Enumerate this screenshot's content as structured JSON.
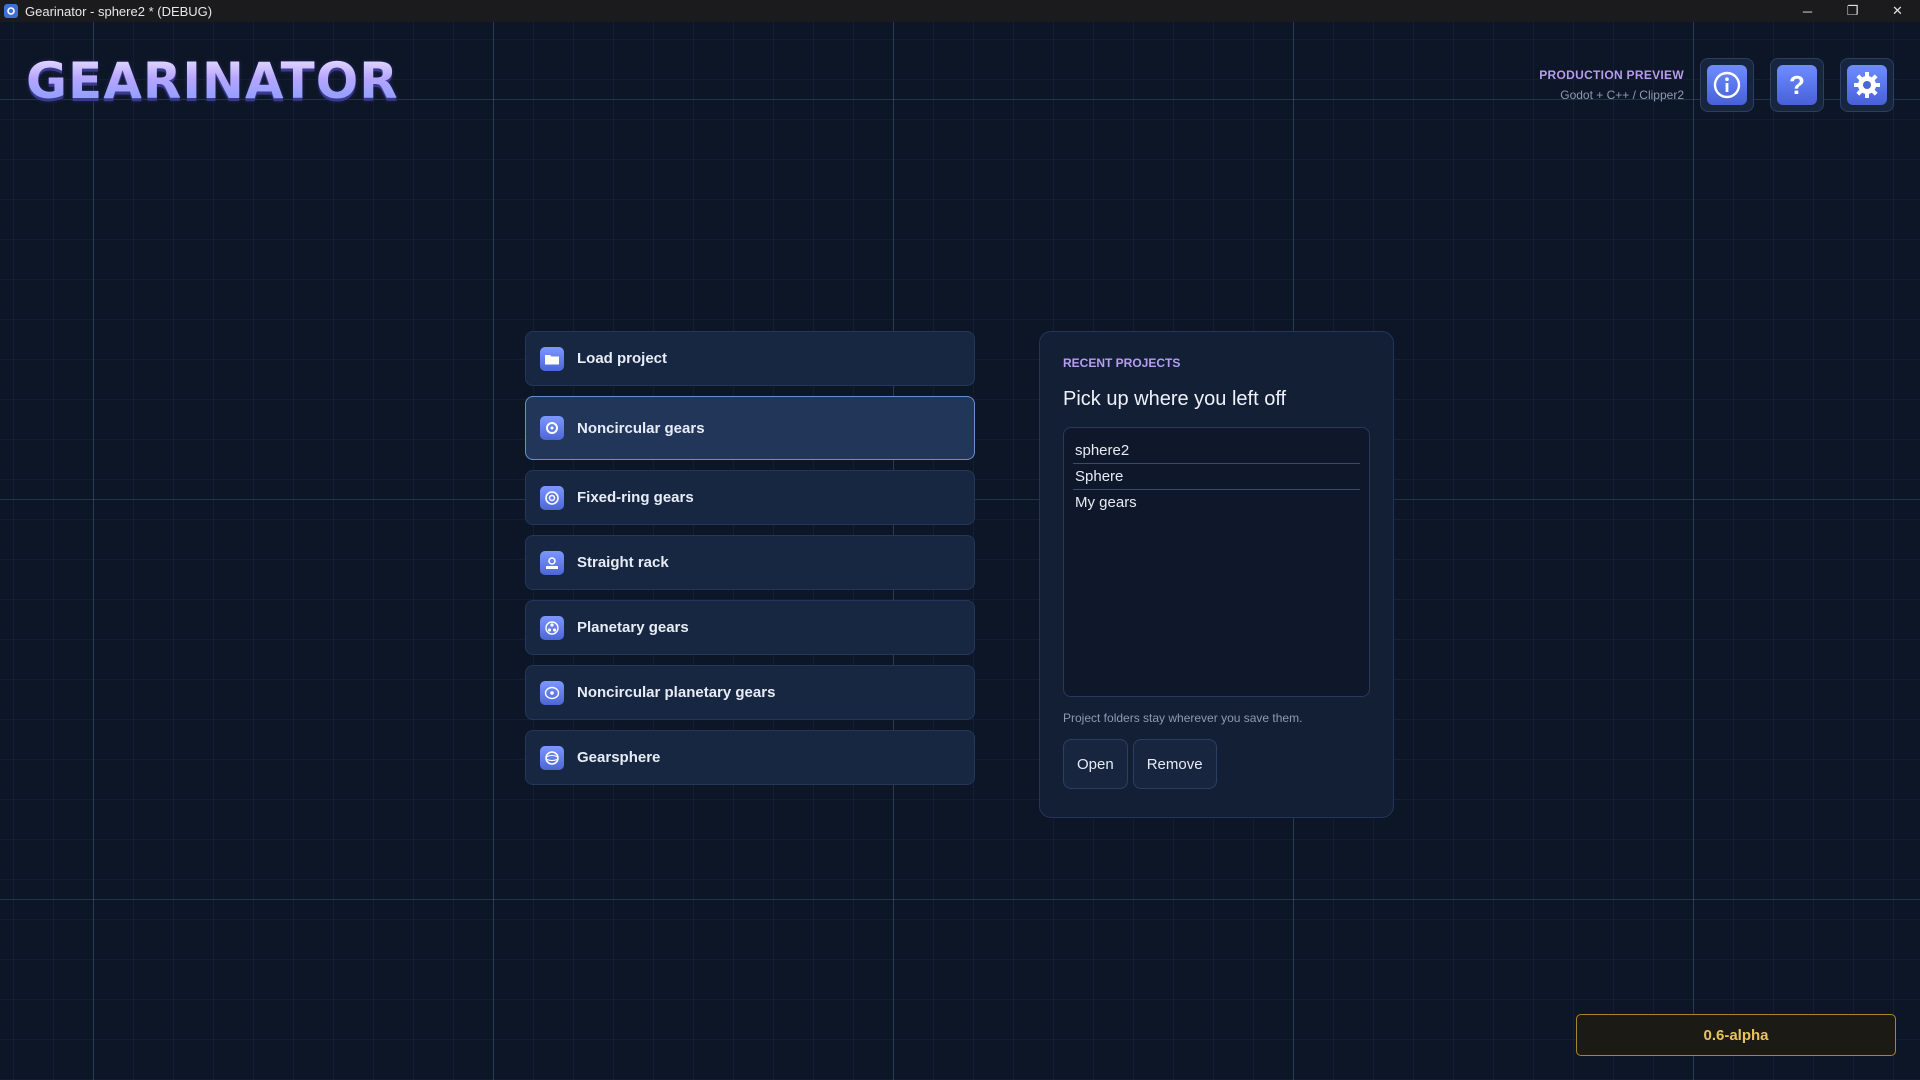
{
  "window": {
    "title": "Gearinator - sphere2 * (DEBUG)",
    "controls": {
      "minimize": "─",
      "restore": "❐",
      "close": "✕"
    }
  },
  "logo": {
    "text": "GEARINATOR"
  },
  "header": {
    "badge": "PRODUCTION PREVIEW",
    "tech": "Godot + C++ / Clipper2",
    "buttons": [
      {
        "name": "info",
        "glyph": "ⓘ"
      },
      {
        "name": "help",
        "glyph": "?"
      },
      {
        "name": "settings",
        "glyph": "⚙"
      }
    ]
  },
  "menu": {
    "items": [
      {
        "label": "Load project",
        "icon": "folder-icon",
        "selected": false
      },
      {
        "label": "Noncircular gears",
        "icon": "gear-icon",
        "selected": true
      },
      {
        "label": "Fixed-ring gears",
        "icon": "ring-gear-icon",
        "selected": false
      },
      {
        "label": "Straight rack",
        "icon": "rack-icon",
        "selected": false
      },
      {
        "label": "Planetary gears",
        "icon": "planetary-icon",
        "selected": false
      },
      {
        "label": "Noncircular planetary gears",
        "icon": "noncircular-planetary-icon",
        "selected": false
      },
      {
        "label": "Gearsphere",
        "icon": "gearsphere-icon",
        "selected": false
      }
    ]
  },
  "recent": {
    "kicker": "RECENT PROJECTS",
    "heading": "Pick up where you left off",
    "projects": [
      "sphere2",
      "Sphere",
      "My gears"
    ],
    "hint": "Project folders stay wherever you save them.",
    "open_label": "Open",
    "remove_label": "Remove"
  },
  "version": "0.6-alpha",
  "colors": {
    "background": "#0d1626",
    "accent_purple": "#b69df2",
    "accent_blue": "#5a75e8",
    "version_gold": "#e9c35a"
  }
}
